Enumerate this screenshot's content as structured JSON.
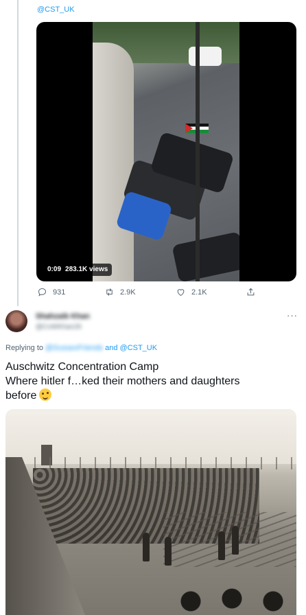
{
  "quoted_tweet": {
    "mention": "@CST_UK",
    "video": {
      "duration": "0:09",
      "views": "283.1K views"
    },
    "actions": {
      "replies": "931",
      "retweets": "2.9K",
      "likes": "2.1K"
    }
  },
  "reply_tweet": {
    "author_name": "Shahzaib Khan",
    "author_handle": "@CoWKhan26",
    "replying_prefix": "Replying to",
    "replying_blurred_handle": "@SussexFriends",
    "replying_and": "and",
    "replying_handle": "@CST_UK",
    "text_lines": [
      "Auschwitz Concentration Camp",
      "Where hitler f…ked their mothers and daughters",
      "before"
    ],
    "emoji": "winking-face"
  },
  "icons": {
    "reply": "reply-icon",
    "retweet": "retweet-icon",
    "like": "heart-icon",
    "share": "share-icon",
    "more": "more-icon"
  },
  "colors": {
    "link": "#1d9bf0",
    "muted": "#536471",
    "text": "#0f1419",
    "divider": "#cfd9de"
  }
}
